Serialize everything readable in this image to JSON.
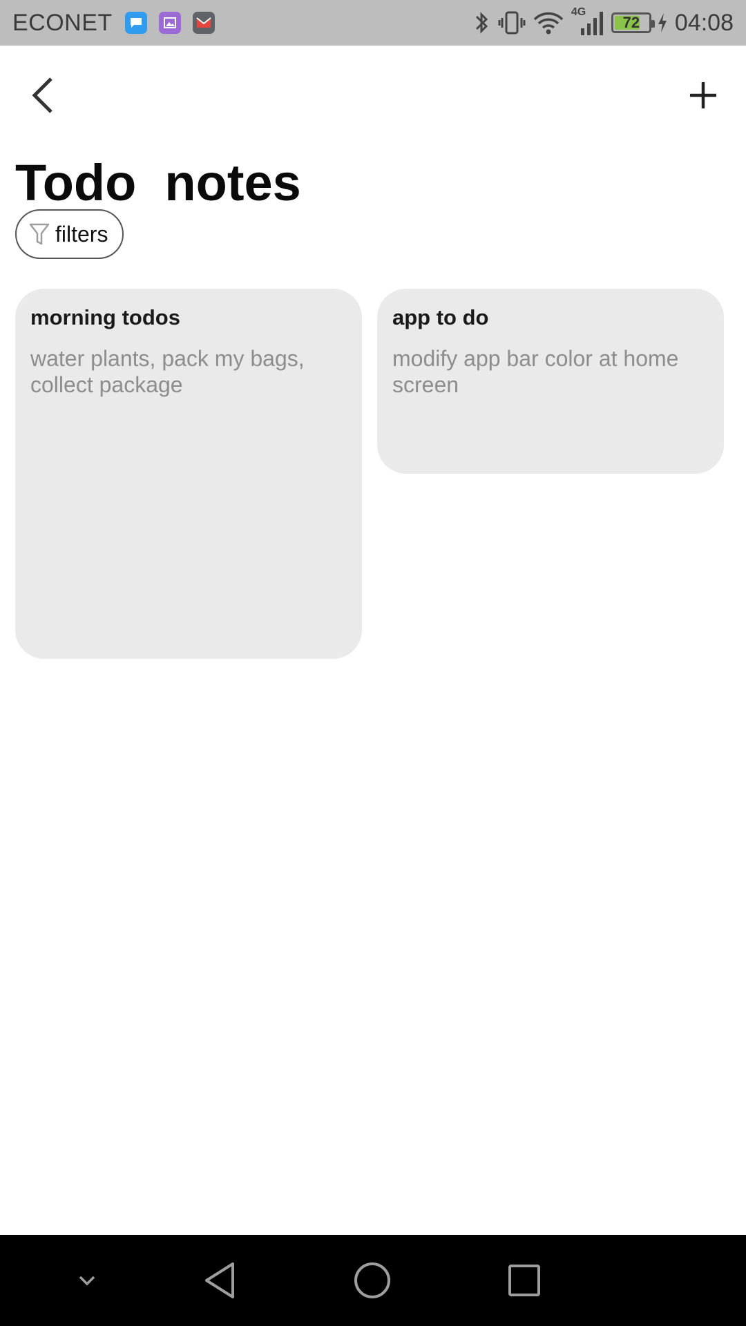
{
  "status_bar": {
    "carrier": "ECONET",
    "notifications": [
      {
        "icon": "messages-icon",
        "color": "#2f9cf0"
      },
      {
        "icon": "gallery-icon",
        "color": "#9c6ad6"
      },
      {
        "icon": "gmail-icon",
        "color": "#5f6368"
      }
    ],
    "network_label": "4G",
    "battery_percent": 72,
    "battery_label": "72",
    "time": "04:08"
  },
  "app_bar": {
    "back_icon": "chevron-left-icon",
    "add_icon": "plus-icon"
  },
  "page": {
    "title": "Todo  notes",
    "filters_label": "filters"
  },
  "notes": [
    {
      "title": "morning todos",
      "body": "water plants, pack my bags, collect package"
    },
    {
      "title": "app to do",
      "body": "modify app bar color at home screen"
    }
  ],
  "colors": {
    "status_bar_bg": "#bdbdbd",
    "card_bg": "#eaeaea",
    "nav_bar_bg": "#000000",
    "battery_fill": "#8bc34a"
  }
}
